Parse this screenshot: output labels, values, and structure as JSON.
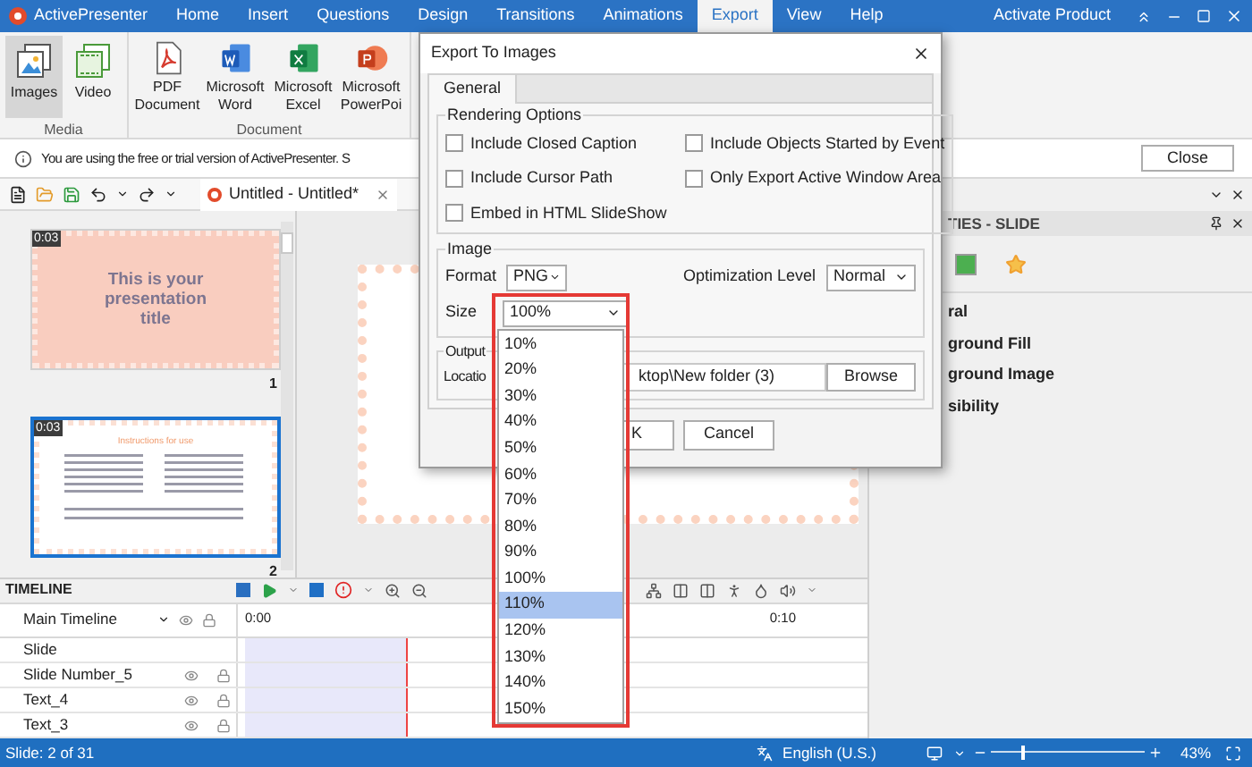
{
  "app": {
    "title": "ActivePresenter",
    "activate": "Activate Product"
  },
  "menu": [
    {
      "label": "Home",
      "selected": false
    },
    {
      "label": "Insert",
      "selected": false
    },
    {
      "label": "Questions",
      "selected": false
    },
    {
      "label": "Design",
      "selected": false
    },
    {
      "label": "Transitions",
      "selected": false
    },
    {
      "label": "Animations",
      "selected": false
    },
    {
      "label": "Export",
      "selected": true
    },
    {
      "label": "View",
      "selected": false
    },
    {
      "label": "Help",
      "selected": false
    }
  ],
  "ribbon": [
    {
      "label": "Media",
      "items": [
        {
          "label": "Images",
          "kind": "images",
          "selected": true
        },
        {
          "label": "Video",
          "kind": "video",
          "selected": false
        }
      ]
    },
    {
      "label": "Document",
      "items": [
        {
          "label": "PDF Document",
          "kind": "pdf",
          "selected": false
        },
        {
          "label": "Microsoft Word",
          "kind": "word",
          "selected": false
        },
        {
          "label": "Microsoft Excel",
          "kind": "excel",
          "selected": false
        },
        {
          "label": "Microsoft PowerPoi",
          "kind": "powerpoint",
          "selected": false
        }
      ]
    }
  ],
  "notice": {
    "text": "You are using the free or trial version of ActivePresenter. S",
    "button": "Close"
  },
  "doc_tabs": [
    {
      "label": "Untitled - Untitled*",
      "selected": true
    }
  ],
  "slides": [
    {
      "kind": "title",
      "duration": "0:03",
      "title": "This is your presentation title",
      "number": "1",
      "selected": false
    },
    {
      "kind": "text",
      "duration": "0:03",
      "title": "Instructions for use",
      "number": "2",
      "selected": true
    }
  ],
  "properties": {
    "title": "TIES - SLIDE",
    "sections": [
      "ral",
      "ground Fill",
      "ground Image",
      "sibility"
    ]
  },
  "timeline": {
    "title": "TIMELINE",
    "track_header": "Main Timeline",
    "ruler": [
      "0:00",
      "0:10"
    ],
    "rows": [
      {
        "name": "Slide",
        "controls": false
      },
      {
        "name": "Slide Number_5",
        "controls": true
      },
      {
        "name": "Text_4",
        "controls": true
      },
      {
        "name": "Text_3",
        "controls": true
      }
    ]
  },
  "status": {
    "slide": "Slide: 2 of 31",
    "language": "English (U.S.)",
    "zoom": "43%",
    "zoom_slider": {
      "level": 0.2
    }
  },
  "dialog": {
    "title": "Export To Images",
    "tabs": [
      {
        "label": "General",
        "selected": true
      }
    ],
    "rendering": {
      "title": "Rendering Options",
      "options": [
        {
          "label": "Include Closed Caption",
          "checked": false
        },
        {
          "label": "Include Objects Started by Event",
          "checked": false
        },
        {
          "label": "Include Cursor Path",
          "checked": false
        },
        {
          "label": "Only Export Active Window Area",
          "checked": false
        },
        {
          "label": "Embed in HTML SlideShow",
          "checked": false
        }
      ]
    },
    "image": {
      "title": "Image",
      "format_label": "Format",
      "format": "PNG",
      "optimization_label": "Optimization Level",
      "optimization": "Normal",
      "size_label": "Size",
      "size": "100%"
    },
    "output": {
      "title": "Output",
      "location_label": "Locatio",
      "location": "ktop\\New folder (3)",
      "browse": "Browse"
    },
    "buttons": [
      "K",
      "Cancel"
    ]
  },
  "size_dropdown": [
    {
      "label": "10%",
      "selected": false
    },
    {
      "label": "20%",
      "selected": false
    },
    {
      "label": "30%",
      "selected": false
    },
    {
      "label": "40%",
      "selected": false
    },
    {
      "label": "50%",
      "selected": false
    },
    {
      "label": "60%",
      "selected": false
    },
    {
      "label": "70%",
      "selected": false
    },
    {
      "label": "80%",
      "selected": false
    },
    {
      "label": "90%",
      "selected": false
    },
    {
      "label": "100%",
      "selected": false
    },
    {
      "label": "110%",
      "selected": true
    },
    {
      "label": "120%",
      "selected": false
    },
    {
      "label": "130%",
      "selected": false
    },
    {
      "label": "140%",
      "selected": false
    },
    {
      "label": "150%",
      "selected": false
    }
  ]
}
